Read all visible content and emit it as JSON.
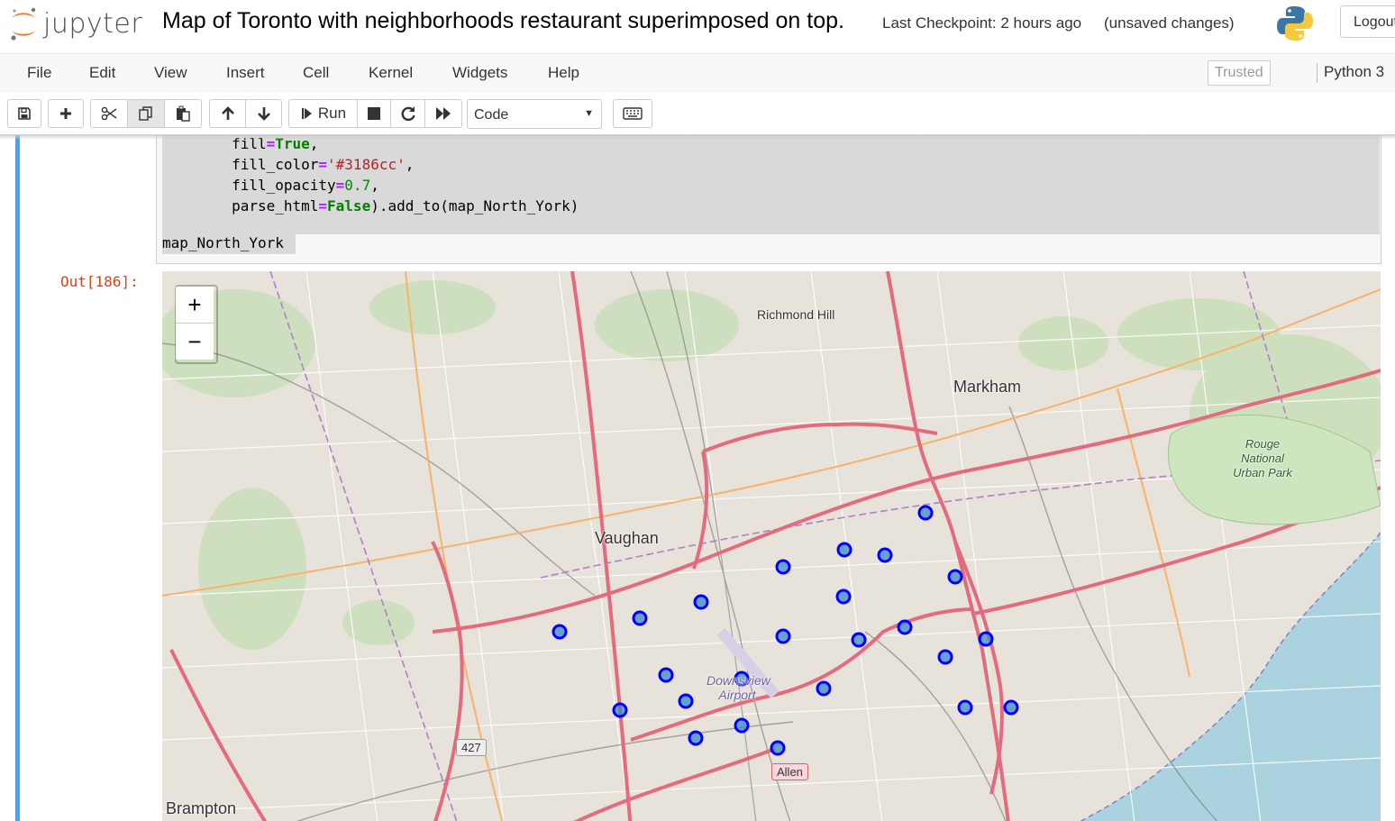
{
  "header": {
    "logo_text": "jupyter",
    "notebook_title": "Map of Toronto with neighborhoods restaurant superimposed on top.",
    "checkpoint": "Last Checkpoint: 2 hours ago",
    "unsaved": "(unsaved changes)",
    "logout_label": "Logout"
  },
  "menubar": {
    "items": [
      "File",
      "Edit",
      "View",
      "Insert",
      "Cell",
      "Kernel",
      "Widgets",
      "Help"
    ],
    "trusted_label": "Trusted",
    "kernel_name": "Python 3"
  },
  "toolbar": {
    "run_label": "Run",
    "cell_type": "Code"
  },
  "cell": {
    "code_lines": [
      {
        "indent": "        ",
        "name": "fill",
        "value": "True",
        "type": "kw",
        "trail": ","
      },
      {
        "indent": "        ",
        "name": "fill_color",
        "value": "'#3186cc'",
        "type": "str",
        "trail": ","
      },
      {
        "indent": "        ",
        "name": "fill_opacity",
        "value": "0.7",
        "type": "num",
        "trail": ","
      },
      {
        "indent": "        ",
        "name": "parse_html",
        "value": "False",
        "type": "kw",
        "trail": ").add_to(map_North_York)"
      }
    ],
    "last_line": "map_North_York",
    "out_prompt": "Out[186]:"
  },
  "map": {
    "zoom_in": "+",
    "zoom_out": "−",
    "labels": {
      "richmond_hill": "Richmond Hill",
      "markham": "Markham",
      "vaughan": "Vaughan",
      "brampton": "Brampton",
      "rouge_park": "Rouge National Urban Park",
      "downsview": "Downsview Airport",
      "allen": "Allen",
      "hwy_427": "427"
    },
    "marker_color": "#0000ff",
    "marker_fill": "#3186cc"
  }
}
